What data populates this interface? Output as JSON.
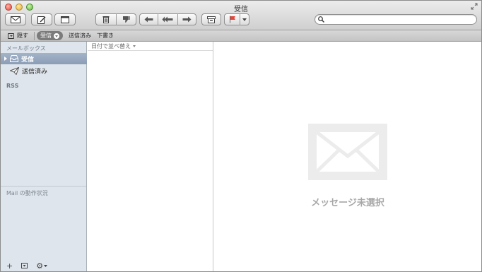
{
  "window": {
    "title": "受信"
  },
  "toolbar": {
    "buttons": [
      {
        "name": "get-mail",
        "icon": "envelope-icon"
      },
      {
        "name": "compose",
        "icon": "compose-icon"
      },
      {
        "name": "hide-mailbox",
        "icon": "sidebar-icon"
      },
      {
        "name": "delete",
        "icon": "trash-icon"
      },
      {
        "name": "junk",
        "icon": "thumbs-down-icon"
      },
      {
        "name": "reply",
        "icon": "reply-icon"
      },
      {
        "name": "reply-all",
        "icon": "reply-all-icon"
      },
      {
        "name": "forward",
        "icon": "forward-icon"
      },
      {
        "name": "archive",
        "icon": "archive-icon"
      },
      {
        "name": "flag",
        "icon": "flag-icon"
      }
    ],
    "flag_color": "#e2463a"
  },
  "search": {
    "placeholder": "",
    "value": ""
  },
  "favorites": {
    "hide_label": "隠す",
    "inbox_label": "受信",
    "sent_label": "送信済み",
    "drafts_label": "下書き"
  },
  "sidebar": {
    "header": "メールボックス",
    "items": [
      {
        "label": "受信",
        "icon": "inbox-tray-icon",
        "selected": true
      },
      {
        "label": "送信済み",
        "icon": "paper-plane-icon",
        "selected": false
      }
    ],
    "rss_label": "RSS",
    "activity_label": "Mail の動作状況",
    "footer": {
      "add": "+",
      "gear": "⚙"
    }
  },
  "message_list": {
    "sort_label": "日付で並べ替え"
  },
  "preview": {
    "empty_text": "メッセージ未選択"
  },
  "colors": {
    "selection": "#8b9db6",
    "sidebar_bg": "#dfe5ec"
  }
}
